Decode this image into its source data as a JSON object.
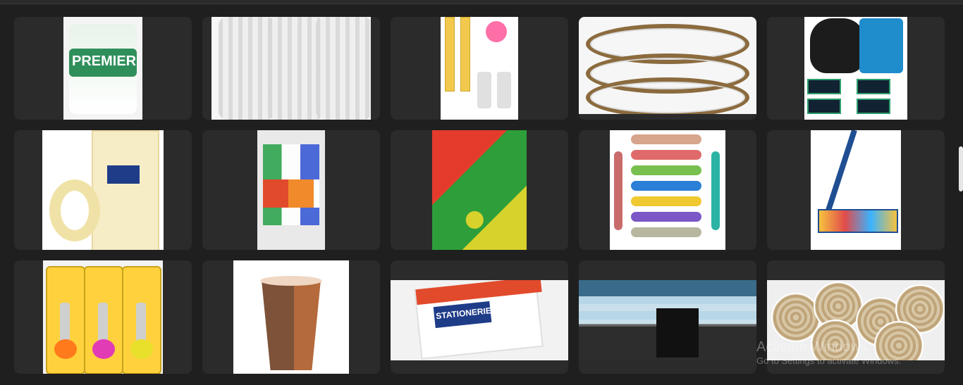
{
  "page": {
    "theme": {
      "background": "#1f1f1f",
      "card": "#2b2b2b",
      "accent_scroll": "#e6e6e6"
    }
  },
  "images": [
    {
      "name": "premier-kitchen-towel",
      "text": "PREMIER"
    },
    {
      "name": "bubble-wrap-rolls"
    },
    {
      "name": "party-popper-snow-spray"
    },
    {
      "name": "paper-plates-stack"
    },
    {
      "name": "garbage-bags-and-bin"
    },
    {
      "name": "abro-masking-tape"
    },
    {
      "name": "plastic-file-folders"
    },
    {
      "name": "rubber-bands"
    },
    {
      "name": "paper-cutters"
    },
    {
      "name": "floor-wiper-mop"
    },
    {
      "name": "scissors-pack"
    },
    {
      "name": "paper-coffee-cup"
    },
    {
      "name": "stationeries-banner",
      "text": "STATIONERIES"
    },
    {
      "name": "shop-interior"
    },
    {
      "name": "paper-plates-bundles"
    }
  ],
  "watermark": {
    "line1": "Activate Windows",
    "line2": "Go to Settings to activate Windows."
  }
}
